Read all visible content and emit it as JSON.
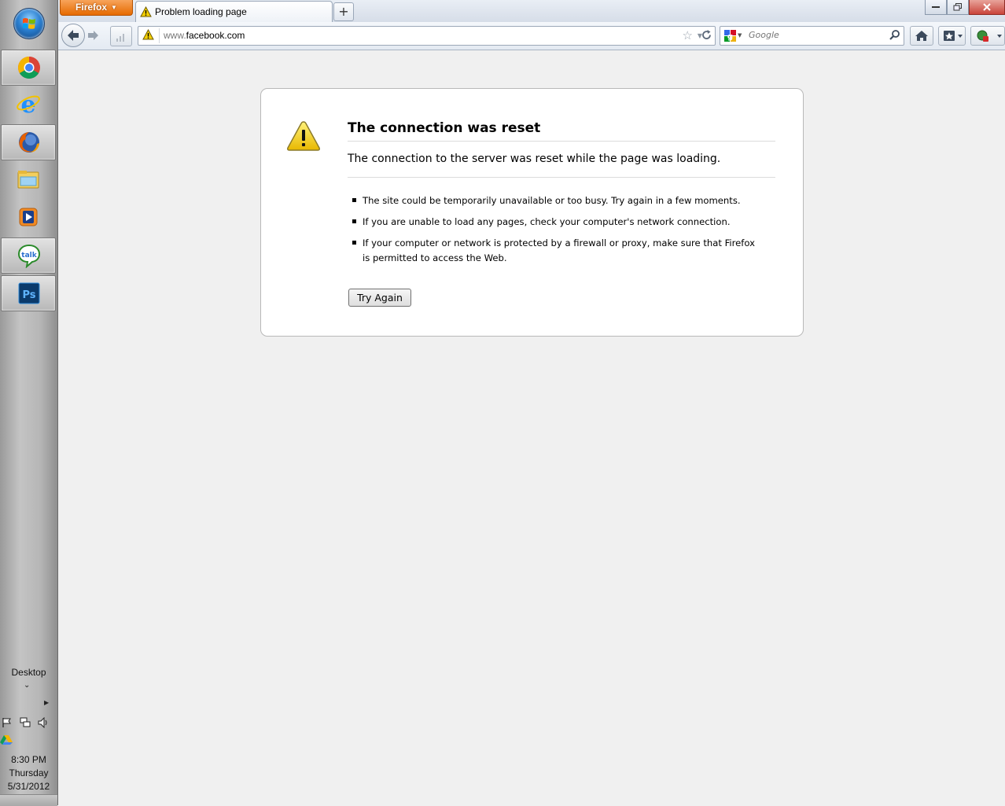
{
  "taskbar": {
    "apps": [
      {
        "name": "start-button"
      },
      {
        "name": "chrome",
        "active": true
      },
      {
        "name": "internet-explorer",
        "active": false
      },
      {
        "name": "firefox",
        "active": true
      },
      {
        "name": "windows-explorer",
        "active": false
      },
      {
        "name": "windows-media-player",
        "active": false
      },
      {
        "name": "google-talk",
        "active": true
      },
      {
        "name": "photoshop",
        "active": true
      }
    ],
    "desktop_label": "Desktop",
    "clock": {
      "time": "8:30 PM",
      "day": "Thursday",
      "date": "5/31/2012"
    }
  },
  "browser": {
    "menu_label": "Firefox",
    "tab_title": "Problem loading page",
    "new_tab_label": "+",
    "url": {
      "prefix": "www.",
      "domain": "facebook.com"
    },
    "search_placeholder": "Google"
  },
  "error": {
    "title": "The connection was reset",
    "description": "The connection to the server was reset while the page was loading.",
    "bullets": [
      "The site could be temporarily unavailable or too busy. Try again in a few moments.",
      "If you are unable to load any pages, check your computer's network connection.",
      "If your computer or network is protected by a firewall or proxy, make sure that Firefox is permitted to access the Web."
    ],
    "try_again_label": "Try Again"
  },
  "colors": {
    "firefox_menu": "#e66a00",
    "warning_yellow": "#f5d000"
  }
}
